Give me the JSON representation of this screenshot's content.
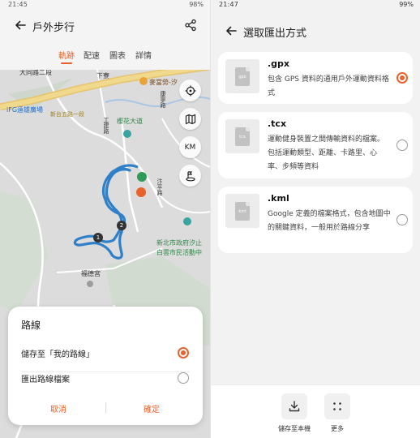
{
  "left": {
    "status": {
      "time": "21:45",
      "battery": "98%"
    },
    "header": {
      "title": "戶外步行",
      "back_icon": "arrow-left-icon",
      "share_icon": "share-icon"
    },
    "tabs": [
      {
        "label": "軌跡",
        "active": true
      },
      {
        "label": "配速",
        "active": false
      },
      {
        "label": "圖表",
        "active": false
      },
      {
        "label": "詳情",
        "active": false
      }
    ],
    "map": {
      "labels": {
        "datong": "大同路二段",
        "xiazhai": "下寮",
        "mcdonalds": "麥當勞-汐",
        "ifg": "iFG遠雄廣場",
        "xintai": "新台五路一段",
        "yinghua": "櫻花大道",
        "pass": "工建路",
        "kangning": "康寧路",
        "hanping": "汴平路",
        "newtaipei": "新北市政府汐止",
        "baiyun": "白雲市民活動中",
        "fude": "福德宮"
      },
      "markers": [
        "1",
        "2"
      ],
      "controls": [
        "location-target-icon",
        "map-layers-icon",
        "KM",
        "mountain-flag-icon"
      ],
      "route_color": "#2f80c9"
    },
    "sheet": {
      "title": "路線",
      "options": [
        {
          "label": "儲存至「我的路線」",
          "selected": true
        },
        {
          "label": "匯出路線檔案",
          "selected": false
        }
      ],
      "cancel": "取消",
      "confirm": "確定"
    }
  },
  "right": {
    "status": {
      "time": "21:47",
      "battery": "99%"
    },
    "header": {
      "title": "選取匯出方式",
      "back_icon": "arrow-left-icon"
    },
    "formats": [
      {
        "thumb": "gpx",
        "ext": ".gpx",
        "description": "包含 GPS 資料的通用戶外運動資料格式",
        "selected": true
      },
      {
        "thumb": "tcx",
        "ext": ".tcx",
        "description": "運動健身裝置之間傳輸資料的檔案。包括運動類型、距離、卡路里、心率、步頻等資料",
        "selected": false
      },
      {
        "thumb": "kml",
        "ext": ".kml",
        "description": "Google 定義的檔案格式，包含地圖中的關鍵資料，一般用於路線分享",
        "selected": false
      }
    ],
    "actions": [
      {
        "label": "儲存至本機",
        "icon": "download-icon"
      },
      {
        "label": "更多",
        "icon": "more-dots-icon"
      }
    ]
  },
  "colors": {
    "accent": "#e8622c",
    "route": "#2f80c9",
    "map_bg": "#dcdcdc"
  }
}
